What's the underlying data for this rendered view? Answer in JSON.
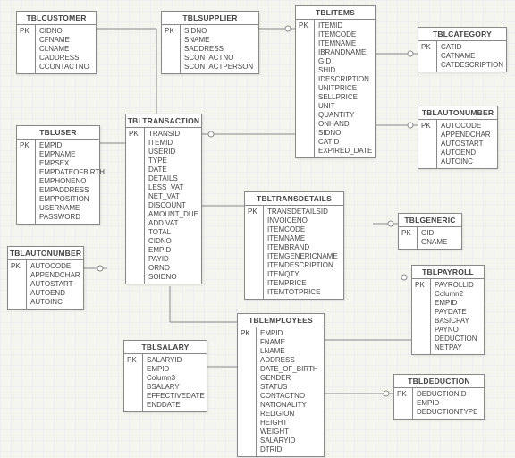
{
  "entities": {
    "customer": {
      "title": "TBLCUSTOMER",
      "pk": "PK",
      "cols": [
        "CIDNO",
        "CFNAME",
        "CLNAME",
        "CADDRESS",
        "CCONTACTNO"
      ]
    },
    "supplier": {
      "title": "TBLSUPPLIER",
      "pk": "PK",
      "cols": [
        "SIDNO",
        "SNAME",
        "SADDRESS",
        "SCONTACTNO",
        "SCONTACTPERSON"
      ]
    },
    "items": {
      "title": "TBLITEMS",
      "pk": "PK",
      "cols": [
        "ITEMID",
        "ITEMCODE",
        "ITEMNAME",
        "IBRANDNAME",
        "GID",
        "SHID",
        "IDESCRIPTION",
        "UNITPRICE",
        "SELLPRICE",
        "UNIT",
        "QUANTITY",
        "ONHAND",
        "SIDNO",
        "CATID",
        "EXPIRED_DATE"
      ]
    },
    "category": {
      "title": "TBLCATEGORY",
      "pk": "PK",
      "cols": [
        "CATID",
        "CATNAME",
        "CATDESCRIPTION"
      ]
    },
    "user": {
      "title": "TBLUSER",
      "pk": "PK",
      "cols": [
        "EMPID",
        "EMPNAME",
        "EMPSEX",
        "EMPDATEOFBIRTH",
        "EMPHONENO",
        "EMPADDRESS",
        "EMPPOSITION",
        "USERNAME",
        "PASSWORD"
      ]
    },
    "transaction": {
      "title": "TBLTRANSACTION",
      "pk": "PK",
      "cols": [
        "TRANSID",
        "ITEMID",
        "USERID",
        "TYPE",
        "DATE",
        "DETAILS",
        "LESS_VAT",
        "NET_VAT",
        "DISCOUNT",
        "AMOUNT_DUE",
        "ADD VAT",
        "TOTAL",
        "CIDNO",
        "EMPID",
        "PAYID",
        "ORNO",
        "SOIDNO"
      ]
    },
    "autonumber1": {
      "title": "TBLAUTONUMBER",
      "pk": "PK",
      "cols": [
        "AUTOCODE",
        "APPENDCHAR",
        "AUTOSTART",
        "AUTOEND",
        "AUTOINC"
      ]
    },
    "autonumber2": {
      "title": "TBLAUTONUMBER",
      "pk": "PK",
      "cols": [
        "AUTOCODE",
        "APPENDCHAR",
        "AUTOSTART",
        "AUTOEND",
        "AUTOINC"
      ]
    },
    "transdetails": {
      "title": "TBLTRANSDETAILS",
      "pk": "PK",
      "cols": [
        "TRANSDETAILSID",
        "INVOICENO",
        "ITEMCODE",
        "ITEMNAME",
        "ITEMBRAND",
        "ITEMGENERICNAME",
        "ITEMDESCRIPTION",
        "ITEMQTY",
        "ITEMPRICE",
        "ITEMTOTPRICE"
      ]
    },
    "generic": {
      "title": "TBLGENERIC",
      "pk": "PK",
      "cols": [
        "GID",
        "GNAME"
      ]
    },
    "payroll": {
      "title": "TBLPAYROLL",
      "pk": "PK",
      "cols": [
        "PAYROLLID",
        "Column2",
        "EMPID",
        "PAYDATE",
        "BASICPAY",
        "PAYNO",
        "DEDUCTION",
        "NETPAY"
      ]
    },
    "salary": {
      "title": "TBLSALARY",
      "pk": "PK",
      "cols": [
        "SALARYID",
        "EMPID",
        "Column3",
        "BSALARY",
        "EFFECTIVEDATE",
        "ENDDATE"
      ]
    },
    "employees": {
      "title": "TBLEMPLOYEES",
      "pk": "PK",
      "cols": [
        "EMPID",
        "FNAME",
        "LNAME",
        "ADDRESS",
        "DATE_OF_BIRTH",
        "GENDER",
        "STATUS",
        "CONTACTNO",
        "NATIONALITY",
        "RELIGION",
        "HEIGHT",
        "WEIGHT",
        "SALARYID",
        "DTRID"
      ]
    },
    "deduction": {
      "title": "TBLDEDUCTION",
      "pk": "PK",
      "cols": [
        "DEDUCTIONID",
        "EMPID",
        "DEDUCTIONTYPE"
      ]
    }
  }
}
